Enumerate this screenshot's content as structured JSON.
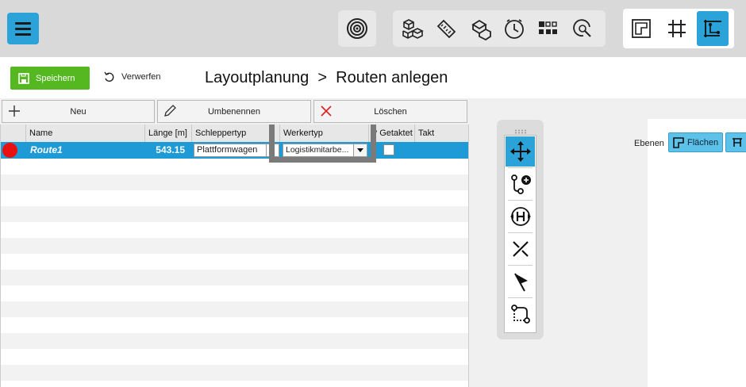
{
  "toolbar": {
    "menu_icon": "hamburger-icon",
    "colors": {
      "accent": "#2ba3d8",
      "active": "#2ba3d8"
    }
  },
  "actions": {
    "save_label": "Speichern",
    "discard_label": "Verwerfen"
  },
  "page": {
    "title": "Layoutplanung  >  Routen anlegen"
  },
  "grid_actions": {
    "new_label": "Neu",
    "rename_label": "Umbenennen",
    "delete_label": "Löschen"
  },
  "grid": {
    "columns": [
      "Name",
      "Länge [m]",
      "Schleppertyp",
      "Werkertyp",
      "Getaktet ?",
      "Takt"
    ],
    "rows": [
      {
        "status_color": "#e81010",
        "name": "Route1",
        "length": "543.15",
        "tug_type": "Plattformwagen",
        "worker_type": "Logistikmitarbe...",
        "clocked": false,
        "takt": ""
      }
    ]
  },
  "layers": {
    "label": "Ebenen",
    "areas_label": "Flächen"
  }
}
